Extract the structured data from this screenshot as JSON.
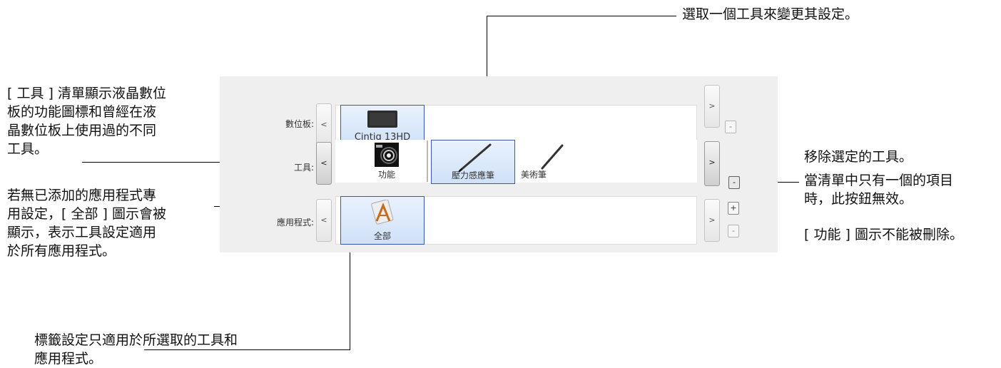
{
  "callouts": {
    "top_right": "選取一個工具來變更其設定。",
    "left_tools": [
      "[ 工具 ] 清單顯示液晶數位",
      "板的功能圖標和曾經在液",
      "晶數位板上使用過的不同",
      "工具。"
    ],
    "left_apps": [
      "若無已添加的應用程式專",
      "用設定，[ 全部 ] 圖示會被",
      "顯示，表示工具設定適用",
      "於所有應用程式。"
    ],
    "bottom": [
      "標籤設定只適用於所選取的工具和",
      "應用程式。"
    ],
    "right_remove": "移除選定的工具。",
    "right_single": [
      "當清單中只有一個的項目",
      "時，此按鈕無效。"
    ],
    "right_function": "[ 功能 ] 圖示不能被刪除。"
  },
  "panel": {
    "tablet_row": {
      "label": "數位板:",
      "prev": "<",
      "next": ">",
      "remove": "-",
      "items": [
        {
          "label": "Cintiq 13HD",
          "icon": "tablet-icon",
          "selected": true
        }
      ]
    },
    "tool_row": {
      "label": "工具:",
      "prev": "<",
      "next": ">",
      "remove": "-",
      "items": [
        {
          "label": "功能",
          "icon": "functions-icon",
          "selected": false
        },
        {
          "label": "壓力感應筆",
          "icon": "pen-icon",
          "selected": true
        },
        {
          "label": "美術筆",
          "icon": "art-pen-icon",
          "selected": false
        }
      ]
    },
    "app_row": {
      "label": "應用程式:",
      "prev": "<",
      "next": ">",
      "add": "+",
      "remove": "-",
      "items": [
        {
          "label": "全部",
          "icon": "all-apps-icon",
          "selected": true
        }
      ]
    }
  },
  "colors": {
    "selection_border": "#3d58a8",
    "selection_fill": "#d8e7fa",
    "panel_bg": "#efefef"
  }
}
